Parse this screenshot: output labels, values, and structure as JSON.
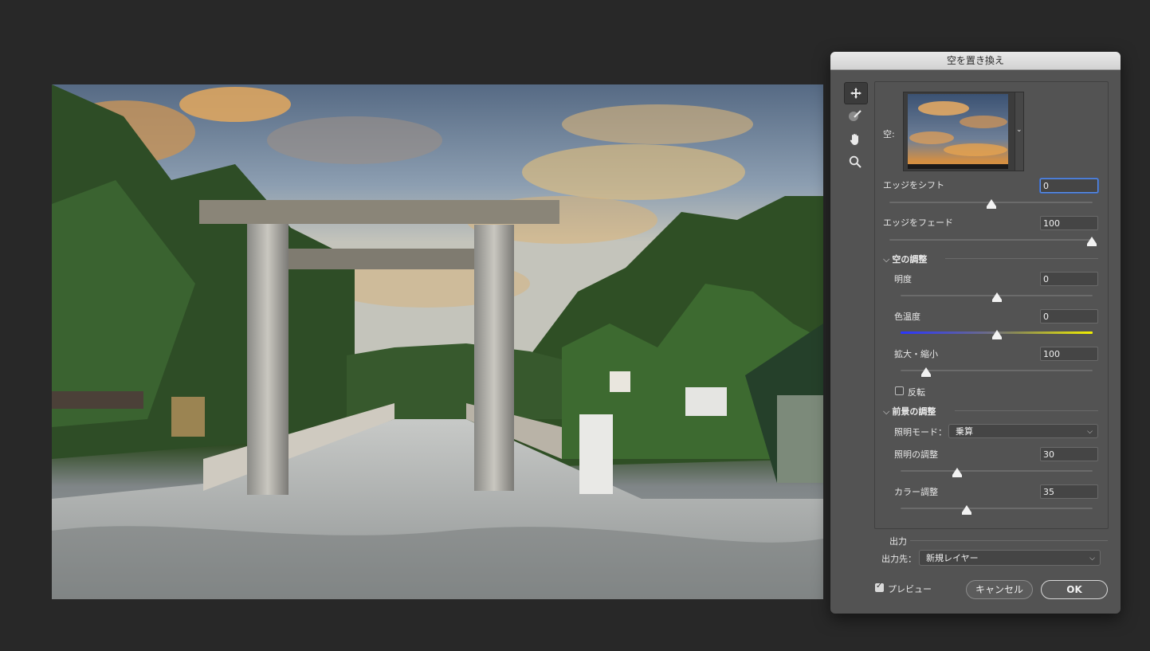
{
  "dialog": {
    "title": "空を置き換え",
    "sky_label": "空:",
    "shift_edge": {
      "label": "エッジをシフト",
      "value": "0",
      "level": 0.5
    },
    "fade_edge": {
      "label": "エッジをフェード",
      "value": "100",
      "level": 1.0
    },
    "sky_adjust": {
      "header": "空の調整",
      "brightness": {
        "label": "明度",
        "value": "0",
        "level": 0.5
      },
      "temperature": {
        "label": "色温度",
        "value": "0",
        "level": 0.5
      },
      "scale": {
        "label": "拡大・縮小",
        "value": "100",
        "level": 0.13
      },
      "flip_label": "反転",
      "flip_checked": false
    },
    "foreground_adjust": {
      "header": "前景の調整",
      "lighting_mode_label": "照明モード：",
      "lighting_mode_value": "乗算",
      "lighting": {
        "label": "照明の調整",
        "value": "30",
        "level": 0.3
      },
      "color": {
        "label": "カラー調整",
        "value": "35",
        "level": 0.35
      }
    },
    "output": {
      "header": "出力",
      "dest_label": "出力先：",
      "dest_value": "新規レイヤー"
    },
    "preview_label": "プレビュー",
    "preview_checked": true,
    "cancel_label": "キャンセル",
    "ok_label": "OK"
  },
  "colors": {
    "background": "#282828",
    "dialog": "#535353",
    "temp_cold": "#2a35ff",
    "temp_warm": "#f2f000"
  },
  "tools": [
    "move-icon",
    "sky-brush-icon",
    "hand-icon",
    "zoom-icon"
  ]
}
